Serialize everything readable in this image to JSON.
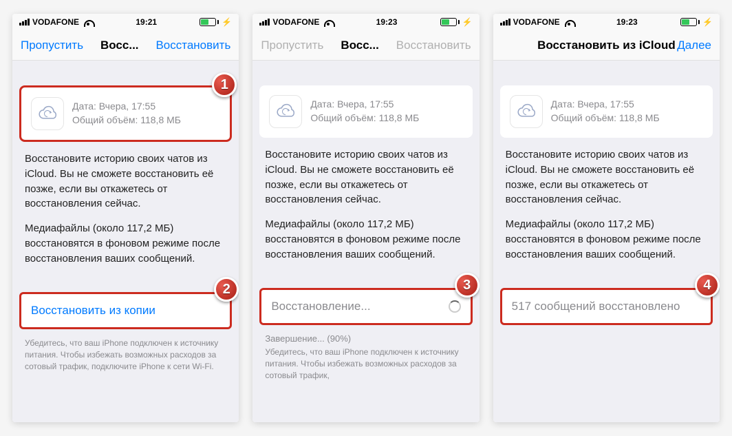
{
  "screens": [
    {
      "status": {
        "carrier": "VODAFONE",
        "time": "19:21"
      },
      "nav": {
        "left": "Пропустить",
        "title": "Восс...",
        "right": "Восстановить",
        "left_dim": false,
        "right_dim": false,
        "wide_title": false
      },
      "backup": {
        "date_label": "Дата: Вчера, 17:55",
        "size_label": "Общий объём: 118,8 МБ",
        "highlight": true
      },
      "desc1": "Восстановите историю своих чатов из iCloud. Вы не сможете восстановить её позже, если вы откажетесь от восстановления сейчас.",
      "desc2": "Медиафайлы (около 117,2 МБ) восстановятся в фоновом режиме после восстановления ваших сообщений.",
      "action": {
        "label": "Восстановить из копии",
        "style": "link",
        "highlight": true,
        "spinner": false
      },
      "completion": "",
      "footer": "Убедитесь, что ваш iPhone подключен к источнику питания. Чтобы избежать возможных расходов за сотовый трафик, подключите iPhone к сети Wi-Fi."
    },
    {
      "status": {
        "carrier": "VODAFONE",
        "time": "19:23"
      },
      "nav": {
        "left": "Пропустить",
        "title": "Восс...",
        "right": "Восстановить",
        "left_dim": true,
        "right_dim": true,
        "wide_title": false
      },
      "backup": {
        "date_label": "Дата: Вчера, 17:55",
        "size_label": "Общий объём: 118,8 МБ",
        "highlight": false
      },
      "desc1": "Восстановите историю своих чатов из iCloud. Вы не сможете восстановить её позже, если вы откажетесь от восстановления сейчас.",
      "desc2": "Медиафайлы (около 117,2 МБ) восстановятся в фоновом режиме после восстановления ваших сообщений.",
      "action": {
        "label": "Восстановление...",
        "style": "gray",
        "highlight": true,
        "spinner": true
      },
      "completion": "Завершение... (90%)",
      "footer": "Убедитесь, что ваш iPhone подключен к источнику питания. Чтобы избежать возможных расходов за сотовый трафик,"
    },
    {
      "status": {
        "carrier": "VODAFONE",
        "time": "19:23"
      },
      "nav": {
        "left": "",
        "title": "Восстановить из iCloud",
        "right": "Далее",
        "left_dim": false,
        "right_dim": false,
        "wide_title": true
      },
      "backup": {
        "date_label": "Дата: Вчера, 17:55",
        "size_label": "Общий объём: 118,8 МБ",
        "highlight": false
      },
      "desc1": "Восстановите историю своих чатов из iCloud. Вы не сможете восстановить её позже, если вы откажетесь от восстановления сейчас.",
      "desc2": "Медиафайлы (около 117,2 МБ) восстановятся в фоновом режиме после восстановления ваших сообщений.",
      "action": {
        "label": "517 сообщений восстановлено",
        "style": "gray",
        "highlight": true,
        "spinner": false
      },
      "completion": "",
      "footer": ""
    }
  ],
  "badges": {
    "screen0_backup": "1",
    "screen0_action": "2",
    "screen1_action": "3",
    "screen2_action": "4"
  }
}
